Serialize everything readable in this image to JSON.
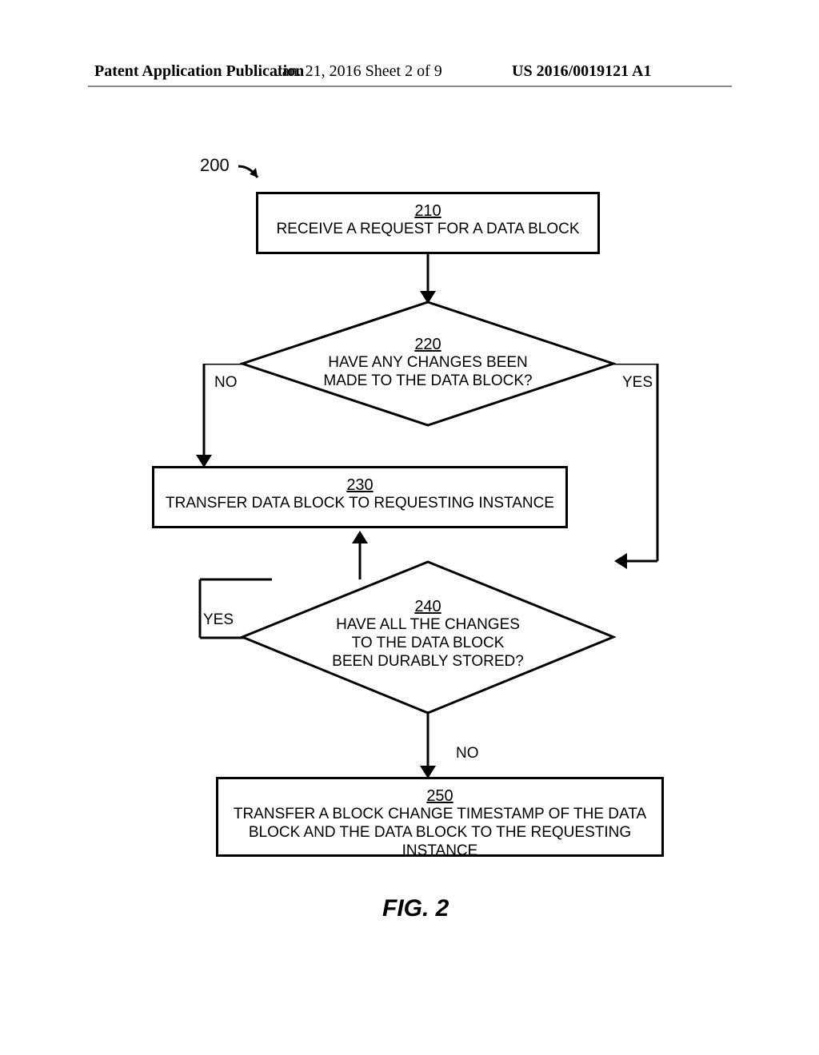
{
  "header": {
    "left": "Patent Application Publication",
    "center": "Jan. 21, 2016  Sheet 2 of 9",
    "right": "US 2016/0019121 A1"
  },
  "ref": "200",
  "step210": {
    "num": "210",
    "text": "RECEIVE A REQUEST FOR A DATA BLOCK"
  },
  "step220": {
    "num": "220",
    "text1": "HAVE ANY CHANGES BEEN",
    "text2": "MADE TO THE DATA BLOCK?",
    "no": "NO",
    "yes": "YES"
  },
  "step230": {
    "num": "230",
    "text": "TRANSFER DATA BLOCK TO REQUESTING INSTANCE"
  },
  "step240": {
    "num": "240",
    "text1": "HAVE ALL THE CHANGES",
    "text2": "TO THE DATA BLOCK",
    "text3": "BEEN DURABLY STORED?",
    "no": "NO",
    "yes": "YES"
  },
  "step250": {
    "num": "250",
    "text1": "TRANSFER A BLOCK CHANGE TIMESTAMP OF THE DATA",
    "text2": "BLOCK AND THE DATA BLOCK TO THE REQUESTING INSTANCE"
  },
  "caption": "FIG. 2",
  "chart_data": {
    "type": "flowchart",
    "title": "FIG. 2",
    "reference_numeral": "200",
    "nodes": [
      {
        "id": "210",
        "type": "process",
        "text": "RECEIVE A REQUEST FOR A DATA BLOCK"
      },
      {
        "id": "220",
        "type": "decision",
        "text": "HAVE ANY CHANGES BEEN MADE TO THE DATA BLOCK?"
      },
      {
        "id": "230",
        "type": "process",
        "text": "TRANSFER DATA BLOCK TO REQUESTING INSTANCE"
      },
      {
        "id": "240",
        "type": "decision",
        "text": "HAVE ALL THE CHANGES TO THE DATA BLOCK BEEN DURABLY STORED?"
      },
      {
        "id": "250",
        "type": "process",
        "text": "TRANSFER A BLOCK CHANGE TIMESTAMP OF THE DATA BLOCK AND THE DATA BLOCK TO THE REQUESTING INSTANCE"
      }
    ],
    "edges": [
      {
        "from": "210",
        "to": "220",
        "label": ""
      },
      {
        "from": "220",
        "to": "230",
        "label": "NO"
      },
      {
        "from": "220",
        "to": "240",
        "label": "YES"
      },
      {
        "from": "240",
        "to": "230",
        "label": "YES"
      },
      {
        "from": "240",
        "to": "250",
        "label": "NO"
      }
    ]
  }
}
